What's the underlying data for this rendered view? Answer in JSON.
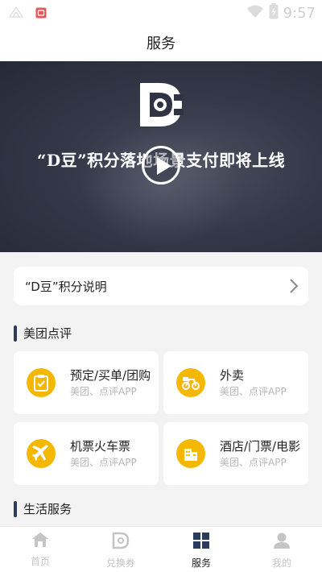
{
  "status_bar": {
    "time": "9:57",
    "icons": [
      "signal-icon",
      "app-notification-icon",
      "wifi-icon",
      "battery-charging-icon"
    ]
  },
  "header": {
    "title": "服务"
  },
  "banner": {
    "headline": "“D豆”积分落地场景支付即将上线",
    "icons": [
      "d-bean-logo-icon",
      "play-icon"
    ]
  },
  "info_card": {
    "label": "“D豆”积分说明",
    "icon": "chevron-right-icon"
  },
  "sections": [
    {
      "title": "美团点评",
      "items": [
        {
          "title": "预定/买单/团购",
          "subtitle": "美团、点评APP",
          "icon": "clipboard-check-icon"
        },
        {
          "title": "外卖",
          "subtitle": "美团、点评APP",
          "icon": "delivery-scooter-icon"
        },
        {
          "title": "机票火车票",
          "subtitle": "美团、点评APP",
          "icon": "airplane-icon"
        },
        {
          "title": "酒店/门票/电影",
          "subtitle": "美团、点评APP",
          "icon": "building-icon"
        }
      ]
    },
    {
      "title": "生活服务",
      "items": []
    }
  ],
  "bottom_nav": {
    "active_index": 2,
    "items": [
      {
        "label": "首页",
        "icon": "home-icon"
      },
      {
        "label": "兑换券",
        "icon": "coupon-icon"
      },
      {
        "label": "服务",
        "icon": "grid-icon"
      },
      {
        "label": "我的",
        "icon": "person-icon"
      }
    ]
  },
  "colors": {
    "accent_yellow": "#f5b700",
    "section_bar": "#2a3b5c",
    "banner_bg": "#2c3040",
    "inactive_nav": "#c4c4c4"
  }
}
